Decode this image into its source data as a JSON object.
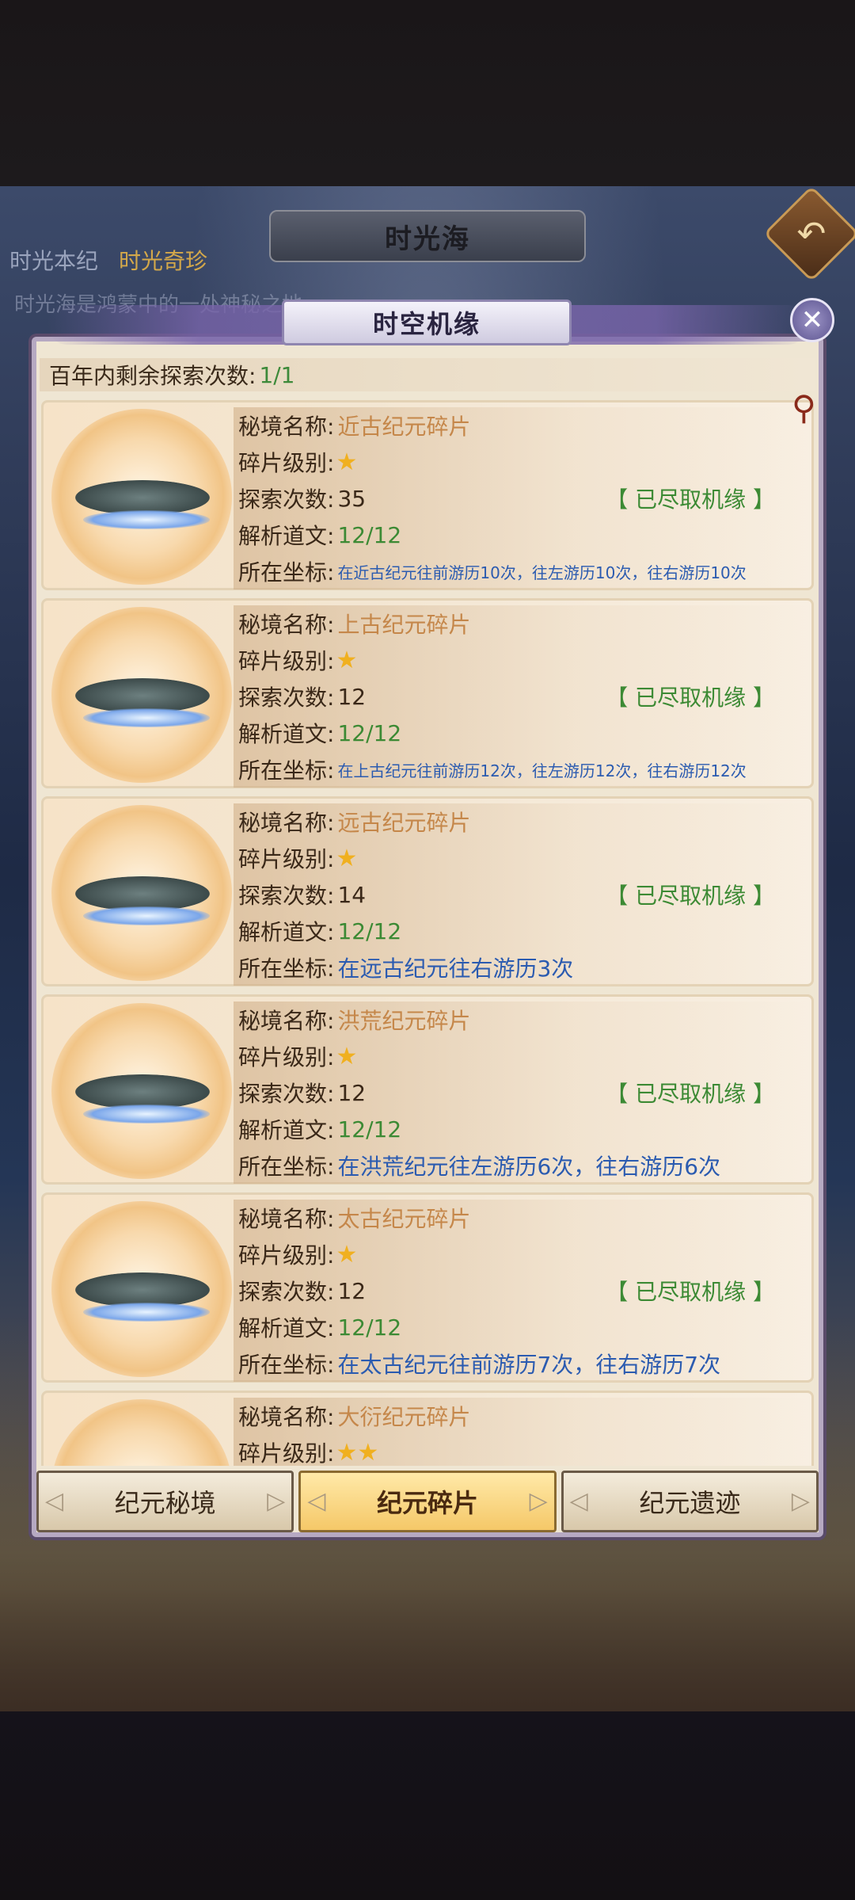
{
  "header": {
    "title": "时光海",
    "tabs": [
      "时光本纪",
      "时光奇珍"
    ],
    "description": "时光海是鸿蒙中的一处神秘之地，…………"
  },
  "modal": {
    "title": "时空机缘",
    "remaining_label": "百年内剩余探索次数:",
    "remaining_value": "1/1"
  },
  "labels": {
    "name": "秘境名称:",
    "level": "碎片级别:",
    "explore": "探索次数:",
    "decode": "解析道文:",
    "coord": "所在坐标:"
  },
  "cards": [
    {
      "name": "近古纪元碎片",
      "stars": "★",
      "explore_count": "35",
      "status": "【 已尽取机缘 】",
      "decode": "12/12",
      "coord": "在近古纪元往前游历10次，往左游历10次，往右游历10次"
    },
    {
      "name": "上古纪元碎片",
      "stars": "★",
      "explore_count": "12",
      "status": "【 已尽取机缘 】",
      "decode": "12/12",
      "coord": "在上古纪元往前游历12次，往左游历12次，往右游历12次"
    },
    {
      "name": "远古纪元碎片",
      "stars": "★",
      "explore_count": "14",
      "status": "【 已尽取机缘 】",
      "decode": "12/12",
      "coord": "在远古纪元往右游历3次"
    },
    {
      "name": "洪荒纪元碎片",
      "stars": "★",
      "explore_count": "12",
      "status": "【 已尽取机缘 】",
      "decode": "12/12",
      "coord": "在洪荒纪元往左游历6次，往右游历6次"
    },
    {
      "name": "太古纪元碎片",
      "stars": "★",
      "explore_count": "12",
      "status": "【 已尽取机缘 】",
      "decode": "12/12",
      "coord": "在太古纪元往前游历7次，往右游历7次"
    },
    {
      "name": "大衍纪元碎片",
      "stars": "★★",
      "explore_count": "",
      "status": "",
      "decode": "",
      "coord": ""
    }
  ],
  "bottom_tabs": [
    "纪元秘境",
    "纪元碎片",
    "纪元遗迹"
  ],
  "active_tab": "纪元碎片",
  "icons": {
    "back": "back-arrow-icon",
    "close": "close-icon",
    "pin": "pin-icon"
  },
  "colors": {
    "name_text": "#c5874a",
    "value_green": "#3c8a34",
    "coord_blue": "#2b5bb0",
    "active_tab": "#f5c868"
  }
}
